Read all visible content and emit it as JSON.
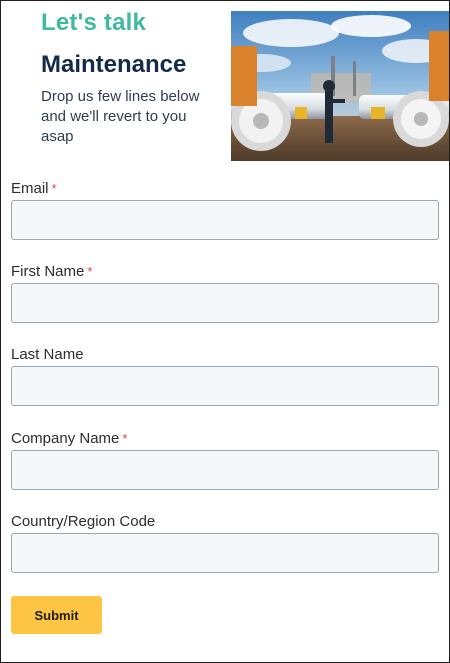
{
  "hero": {
    "kicker": "Let's talk",
    "title": "Maintenance",
    "description": "Drop us few lines below and we'll revert to you asap",
    "photo_alt": "Engineer inspecting industrial pipeline valves"
  },
  "form": {
    "required_marker": "*",
    "fields": [
      {
        "name": "email",
        "label": "Email",
        "required": true,
        "value": "",
        "placeholder": ""
      },
      {
        "name": "first-name",
        "label": "First Name",
        "required": true,
        "value": "",
        "placeholder": ""
      },
      {
        "name": "last-name",
        "label": "Last Name",
        "required": false,
        "value": "",
        "placeholder": ""
      },
      {
        "name": "company-name",
        "label": "Company Name",
        "required": true,
        "value": "",
        "placeholder": ""
      },
      {
        "name": "country-region-code",
        "label": "Country/Region Code",
        "required": false,
        "value": "",
        "placeholder": ""
      }
    ],
    "submit_label": "Submit"
  },
  "colors": {
    "accent": "#3fb9a0",
    "title": "#152b4a",
    "required": "#e0454a",
    "button": "#fec544",
    "input_bg": "#f5f8fa"
  }
}
